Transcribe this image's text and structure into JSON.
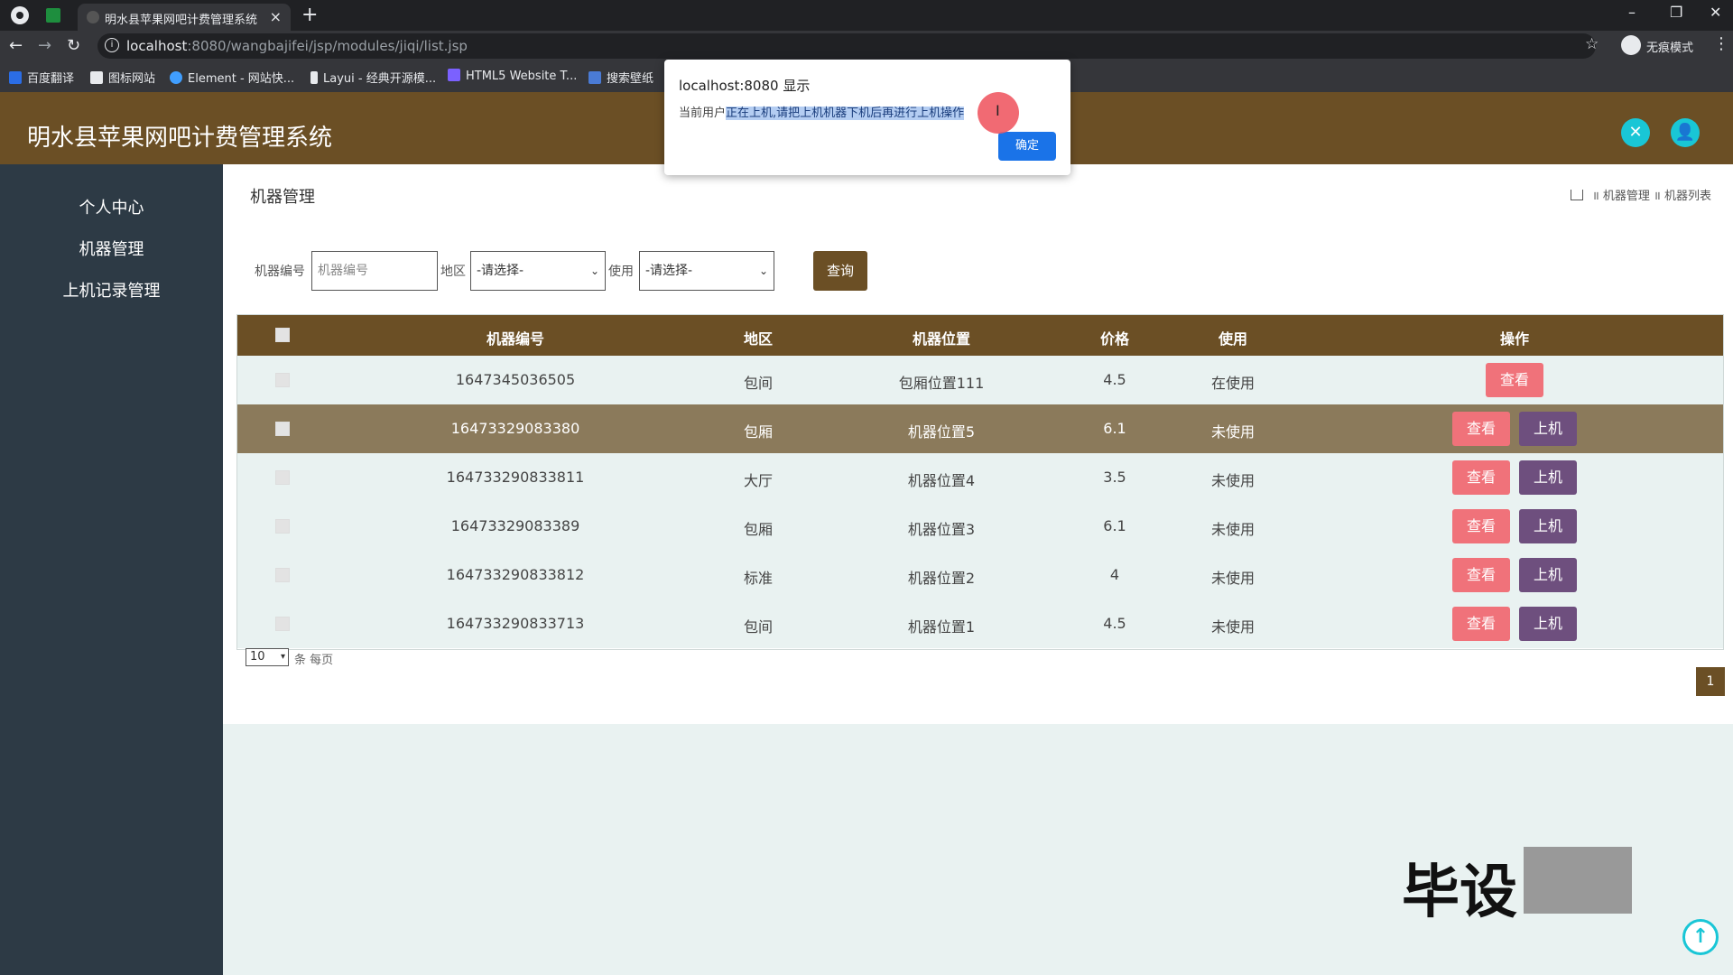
{
  "browser": {
    "tab_title": "明水县苹果网吧计费管理系统",
    "url_host": "localhost",
    "url_rest": ":8080/wangbajifei/jsp/modules/jiqi/list.jsp",
    "incognito_label": "无痕模式",
    "bookmarks": [
      "百度翻译",
      "图标网站",
      "Element - 网站快...",
      "Layui - 经典开源模...",
      "HTML5 Website T...",
      "搜索壁纸"
    ]
  },
  "app": {
    "title": "明水县苹果网吧计费管理系统"
  },
  "sidebar": {
    "items": [
      {
        "label": "个人中心"
      },
      {
        "label": "机器管理"
      },
      {
        "label": "上机记录管理"
      }
    ]
  },
  "page": {
    "section_title": "机器管理",
    "breadcrumb": [
      "机器管理",
      "机器列表"
    ]
  },
  "filters": {
    "code_label": "机器编号",
    "code_placeholder": "机器编号",
    "area_label": "地区",
    "area_value": "-请选择-",
    "use_label": "使用",
    "use_value": "-请选择-",
    "query_button": "查询"
  },
  "table": {
    "headers": [
      "机器编号",
      "地区",
      "机器位置",
      "价格",
      "使用",
      "操作"
    ],
    "rows": [
      {
        "code": "1647345036505",
        "area": "包间",
        "location": "包厢位置111",
        "price": "4.5",
        "status": "在使用",
        "view": "查看",
        "on": ""
      },
      {
        "code": "16473329083380",
        "area": "包厢",
        "location": "机器位置5",
        "price": "6.1",
        "status": "未使用",
        "view": "查看",
        "on": "上机"
      },
      {
        "code": "164733290833811",
        "area": "大厅",
        "location": "机器位置4",
        "price": "3.5",
        "status": "未使用",
        "view": "查看",
        "on": "上机"
      },
      {
        "code": "16473329083389",
        "area": "包厢",
        "location": "机器位置3",
        "price": "6.1",
        "status": "未使用",
        "view": "查看",
        "on": "上机"
      },
      {
        "code": "164733290833812",
        "area": "标准",
        "location": "机器位置2",
        "price": "4",
        "status": "未使用",
        "view": "查看",
        "on": "上机"
      },
      {
        "code": "164733290833713",
        "area": "包间",
        "location": "机器位置1",
        "price": "4.5",
        "status": "未使用",
        "view": "查看",
        "on": "上机"
      }
    ]
  },
  "pagination": {
    "page_size": "10",
    "per_page_label": "条 每页",
    "current_page": "1"
  },
  "dialog": {
    "title": "localhost:8080 显示",
    "message_prefix": "当前用户",
    "message_highlight": "正在上机,请把上机机器下机后再进行上机操作",
    "ok_button": "确定"
  },
  "watermark": "毕设",
  "colors": {
    "brand": "#6b4f25",
    "sidebar": "#2d3a45",
    "view_button": "#f0727a",
    "on_button": "#6e4f7e",
    "accent": "#19c6d6"
  }
}
